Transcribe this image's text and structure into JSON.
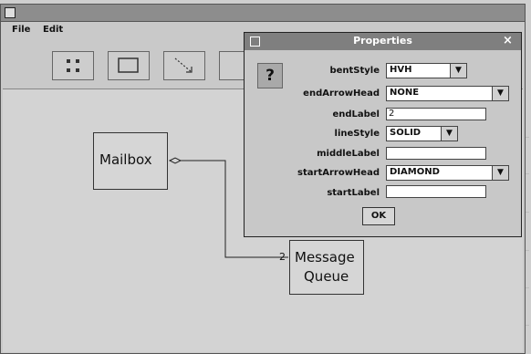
{
  "menubar": {
    "file": "File",
    "edit": "Edit"
  },
  "diagram": {
    "mailbox_label": "Mailbox",
    "queue_label_line1": "Message",
    "queue_label_line2": "Queue",
    "edge_end_label": "2"
  },
  "dialog": {
    "title": "Properties",
    "help_icon": "?",
    "close_icon": "×",
    "props": [
      {
        "name": "bentStyle",
        "value": "HVH",
        "type": "combo"
      },
      {
        "name": "endArrowHead",
        "value": "NONE",
        "type": "combo"
      },
      {
        "name": "endLabel",
        "value": "2",
        "type": "text"
      },
      {
        "name": "lineStyle",
        "value": "SOLID",
        "type": "combo"
      },
      {
        "name": "middleLabel",
        "value": "",
        "type": "text"
      },
      {
        "name": "startArrowHead",
        "value": "DIAMOND",
        "type": "combo"
      },
      {
        "name": "startLabel",
        "value": "",
        "type": "text"
      }
    ],
    "ok_label": "OK"
  }
}
